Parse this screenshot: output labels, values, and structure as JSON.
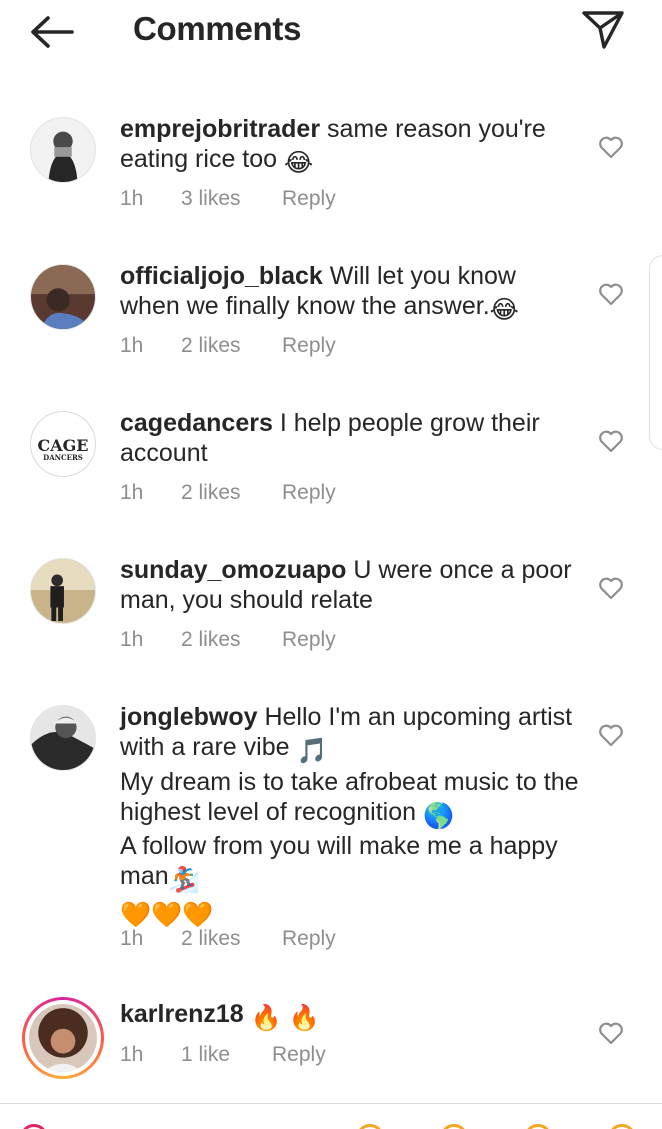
{
  "header": {
    "title": "Comments",
    "back_icon": "arrow-left-icon",
    "send_icon": "paper-plane-icon"
  },
  "comments": [
    {
      "username": "emprejobritrader",
      "text": "same reason you're eating rice too",
      "emoji": "😂",
      "time": "1h",
      "likes": "3 likes",
      "reply": "Reply"
    },
    {
      "username": "officialjojo_black",
      "text": "Will let you know when we finally know the answer.",
      "emoji": "😂",
      "time": "1h",
      "likes": "2 likes",
      "reply": "Reply"
    },
    {
      "username": "cagedancers",
      "text": "I help people grow their account",
      "time": "1h",
      "likes": "2 likes",
      "reply": "Reply",
      "avatar_text": "CAGE",
      "avatar_subtext": "DANCERS"
    },
    {
      "username": "sunday_omozuapo",
      "text": "U were once a poor man, you should relate",
      "time": "1h",
      "likes": "2 likes",
      "reply": "Reply"
    },
    {
      "username": "jonglebwoy",
      "text1": "Hello I'm an upcoming artist with a rare vibe",
      "emoji1": "🎵",
      "text2": "My dream is to take afrobeat music to the highest level of recognition",
      "emoji2": "🌎",
      "text3": "A follow from you will make me a happy man",
      "emoji3": "🏂",
      "emoji4": "🧡🧡🧡",
      "time": "1h",
      "likes": "2 likes",
      "reply": "Reply"
    },
    {
      "username": "karlrenz18",
      "emoji": "🔥 🔥",
      "time": "1h",
      "likes": "1 like",
      "reply": "Reply"
    }
  ],
  "colors": {
    "text": "#262626",
    "secondary": "#8e8e8e",
    "heart_color": "#8e8e8e"
  }
}
